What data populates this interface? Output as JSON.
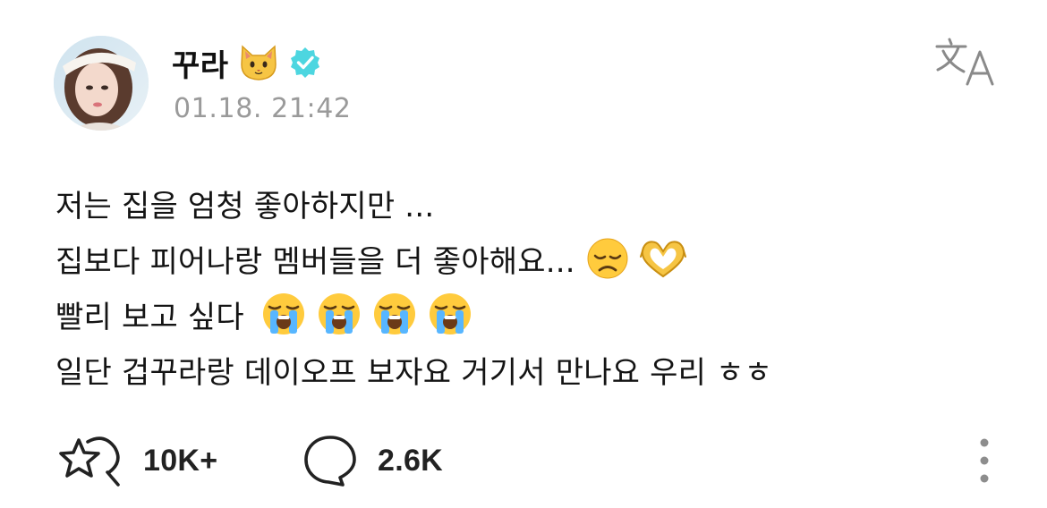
{
  "post": {
    "username": "꾸라",
    "timestamp": "01.18. 21:42",
    "lines": [
      "저는 집을 엄청 좋아하지만 ...",
      "집보다 피어나랑 멤버들을 더 좋아해요...",
      "빨리 보고 싶다",
      "일단 겁꾸라랑 데이오프 보자요 거기서 만나요 우리 ㅎㅎ"
    ],
    "line_emojis": [
      [],
      [
        "disappointed-face-emoji",
        "heart-hands-emoji"
      ],
      [
        "loudly-crying-face-emoji",
        "loudly-crying-face-emoji",
        "loudly-crying-face-emoji",
        "loudly-crying-face-emoji"
      ],
      []
    ],
    "header_emoji": "cat-face-emoji",
    "verified_color": "#4dd6e0"
  },
  "actions": {
    "likes_count": "10K+",
    "comments_count": "2.6K",
    "icons": [
      "like-star-icon",
      "comment-bubble-icon",
      "more-vertical-icon",
      "translate-icon"
    ]
  }
}
